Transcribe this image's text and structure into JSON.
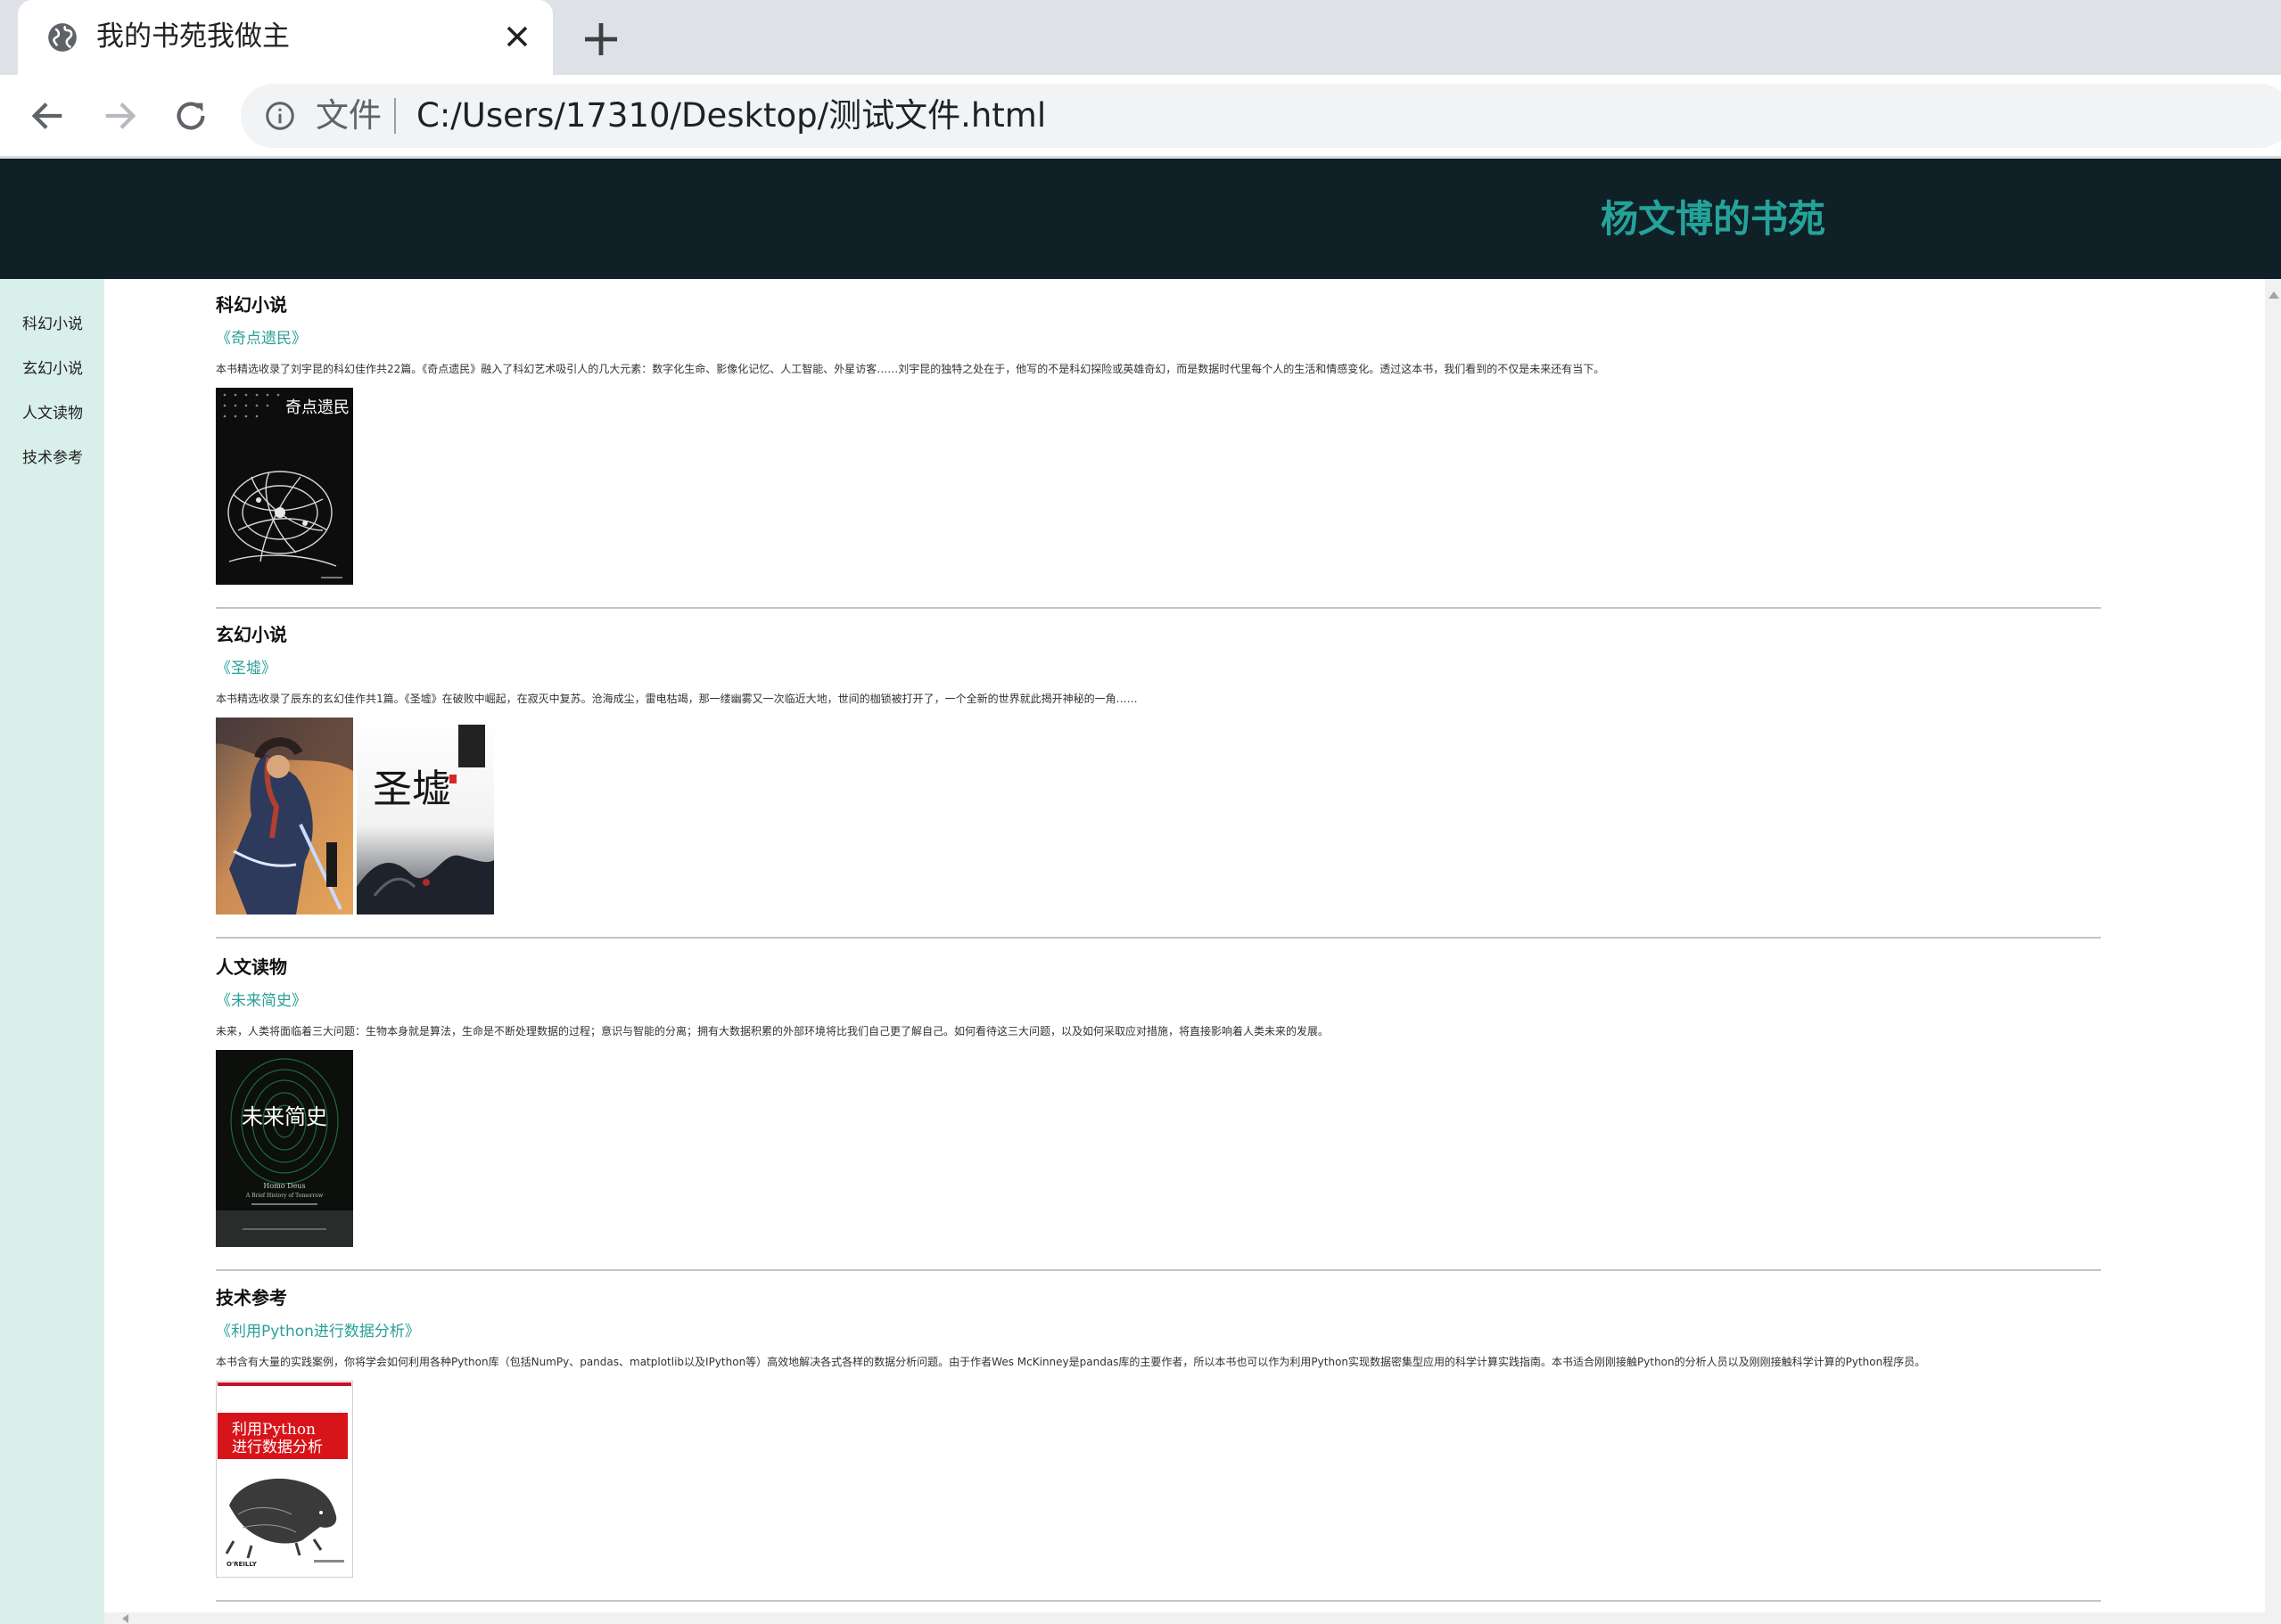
{
  "browser": {
    "tab_title": "我的书苑我做主",
    "scheme_label": "文件",
    "url": "C:/Users/17310/Desktop/测试文件.html"
  },
  "header": {
    "site_title": "杨文博的书苑"
  },
  "sidebar": {
    "items": [
      {
        "label": "科幻小说"
      },
      {
        "label": "玄幻小说"
      },
      {
        "label": "人文读物"
      },
      {
        "label": "技术参考"
      }
    ]
  },
  "sections": [
    {
      "title": "科幻小说",
      "book": "《奇点遗民》",
      "description": "本书精选收录了刘宇昆的科幻佳作共22篇。《奇点遗民》融入了科幻艺术吸引人的几大元素：数字化生命、影像化记忆、人工智能、外星访客……刘宇昆的独特之处在于，他写的不是科幻探险或英雄奇幻，而是数据时代里每个人的生活和情感变化。透过这本书，我们看到的不仅是未来还有当下。",
      "covers": [
        {
          "title_text": "奇点遗民",
          "palette": "black-white-illustration"
        }
      ]
    },
    {
      "title": "玄幻小说",
      "book": "《圣墟》",
      "description": "本书精选收录了辰东的玄幻佳作共1篇。《圣墟》在破败中崛起，在寂灭中复苏。沧海成尘，雷电枯竭，那一缕幽雾又一次临近大地，世间的枷锁被打开了，一个全新的世界就此揭开神秘的一角……",
      "covers": [
        {
          "title_text": "",
          "palette": "warrior-painting"
        },
        {
          "title_text": "圣墟",
          "palette": "ink-calligraphy"
        }
      ]
    },
    {
      "title": "人文读物",
      "book": "《未来简史》",
      "description": "未来，人类将面临着三大问题：生物本身就是算法，生命是不断处理数据的过程；意识与智能的分离；拥有大数据积累的外部环境将比我们自己更了解自己。如何看待这三大问题，以及如何采取应对措施，将直接影响着人类未来的发展。",
      "covers": [
        {
          "title_text": "未来简史",
          "subtitle": "Homo Deus",
          "tagline": "A Brief History of Tomorrow",
          "palette": "green-fingerprint"
        }
      ]
    },
    {
      "title": "技术参考",
      "book": "《利用Python进行数据分析》",
      "description": "本书含有大量的实践案例，你将学会如何利用各种Python库（包括NumPy、pandas、matplotlib以及IPython等）高效地解决各式各样的数据分析问题。由于作者Wes McKinney是pandas库的主要作者，所以本书也可以作为利用Python实现数据密集型应用的科学计算实践指南。本书适合刚刚接触Python的分析人员以及刚刚接触科学计算的Python程序员。",
      "covers": [
        {
          "title_text": "利用Python\n进行数据分析",
          "publisher": "O'REILLY",
          "palette": "oreilly-animal"
        }
      ]
    }
  ],
  "colors": {
    "header_bg": "#0f2027",
    "accent": "#24a39a",
    "sidebar_bg": "#d9efea",
    "link": "#2aa098"
  }
}
